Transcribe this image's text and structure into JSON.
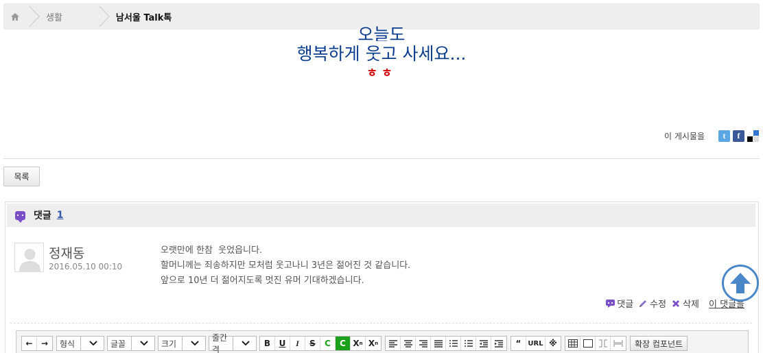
{
  "breadcrumb": {
    "home_icon": "home-icon",
    "items": [
      "생활",
      "남서울 Talk톡"
    ]
  },
  "article": {
    "line1": "오늘도",
    "line2": "행복하게 웃고 사세요...",
    "line3": "ㅎㅎ"
  },
  "share": {
    "label": "이 게시물을",
    "icons": [
      "twitter-icon",
      "facebook-icon",
      "delicious-icon"
    ]
  },
  "list_button": "목록",
  "comments": {
    "title": "댓글",
    "count": "1",
    "items": [
      {
        "author": "정재동",
        "date": "2016.05.10 00:10",
        "lines": [
          "오랫만에 한참  웃었읍니다.",
          "할머니께는 죄송하지만 모처럼 웃고나니 3년은 젊어진 것 같습니다.",
          "앞으로 10년 더 젊어지도록 멋진 유머 기대하겠습니다."
        ],
        "actions": {
          "reply": "댓글",
          "edit": "수정",
          "delete": "삭제",
          "link": "이 댓글을"
        }
      }
    ]
  },
  "editor": {
    "selects": [
      "형식",
      "글꼴",
      "크기",
      "줄간격"
    ],
    "format_buttons": [
      "B",
      "U",
      "I",
      "S",
      "C",
      "C",
      "X",
      "X"
    ],
    "text_buttons": [
      "URL"
    ],
    "extension_label": "확장 컴포넌트"
  },
  "colors": {
    "title_blue": "#0b3d8f",
    "accent_red": "#d40000",
    "comment_purple": "#7a4fc7",
    "scroll_blue": "#4a87c9"
  }
}
